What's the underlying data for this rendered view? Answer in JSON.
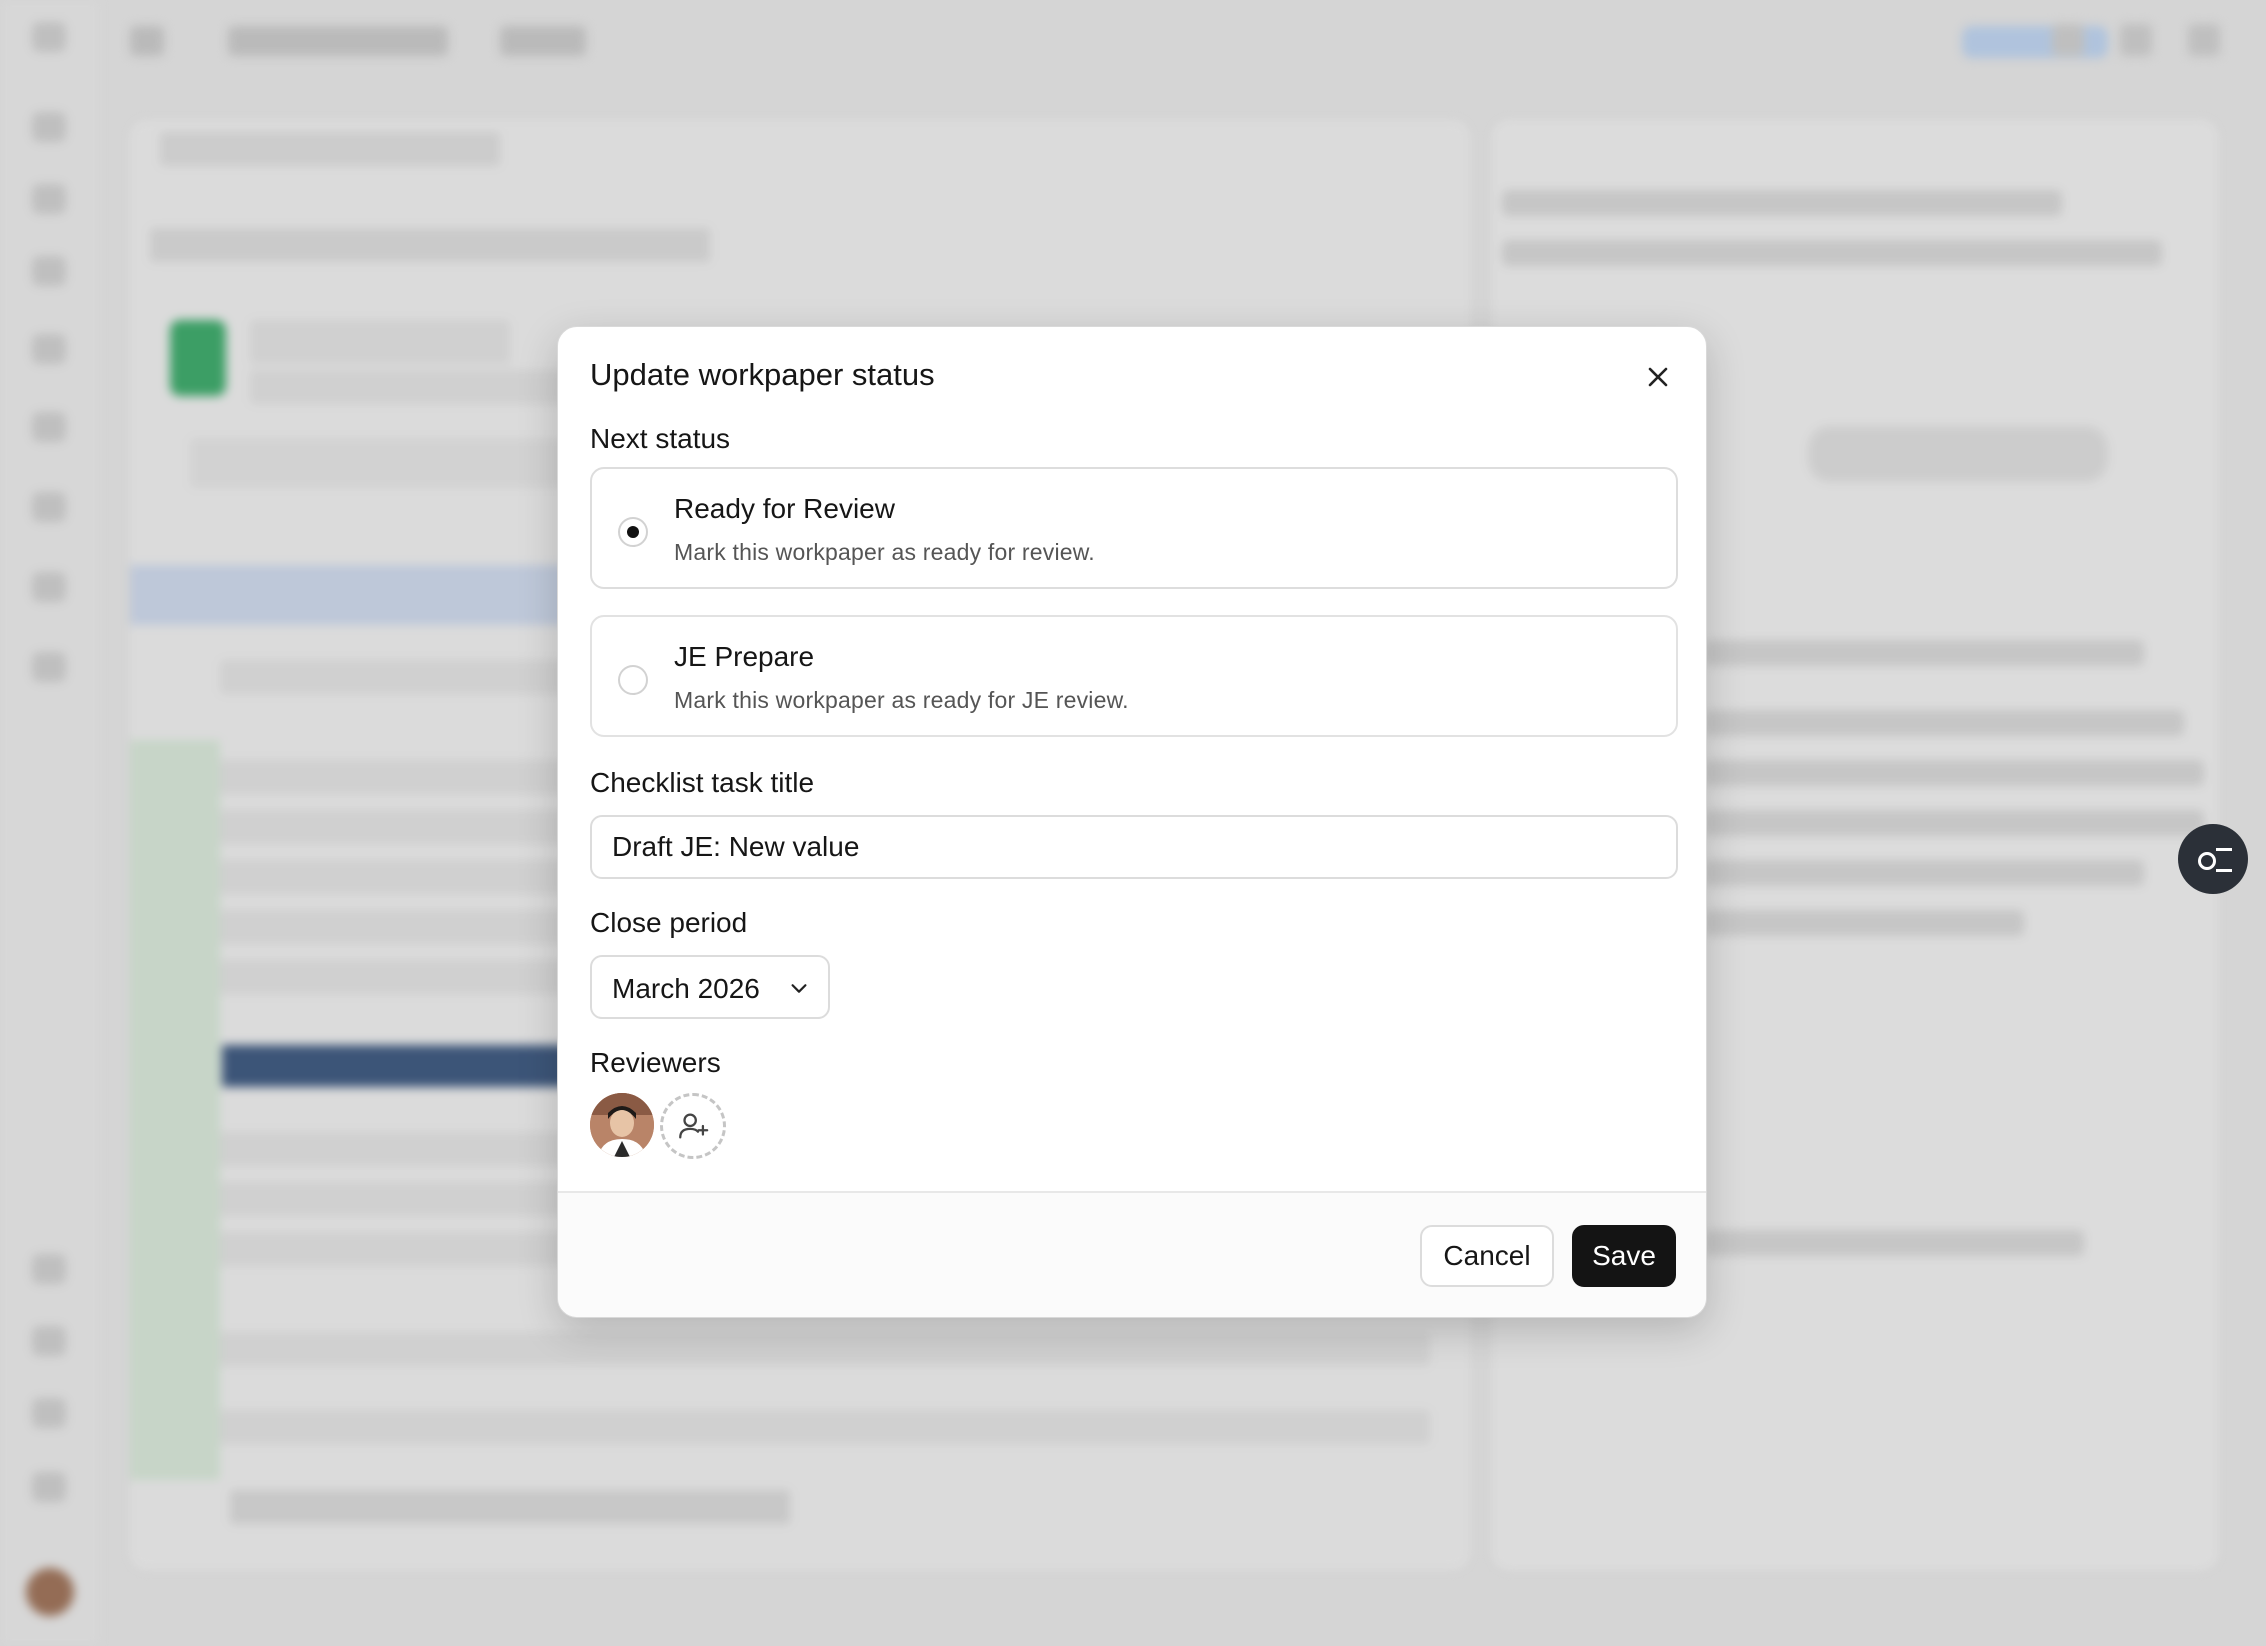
{
  "modal": {
    "title": "Update workpaper status",
    "next_status_label": "Next status",
    "options": [
      {
        "title": "Ready for Review",
        "description": "Mark this workpaper as ready for review.",
        "selected": true
      },
      {
        "title": "JE Prepare",
        "description": "Mark this workpaper as ready for JE review.",
        "selected": false
      }
    ],
    "checklist_label": "Checklist task title",
    "checklist_value": "Draft JE: New value",
    "close_period_label": "Close period",
    "close_period_value": "March 2026",
    "reviewers_label": "Reviewers",
    "cancel_label": "Cancel",
    "save_label": "Save"
  },
  "colors": {
    "primary_button": "#141414",
    "scrim": "#e9e9e9"
  }
}
